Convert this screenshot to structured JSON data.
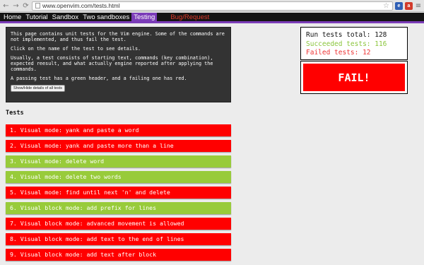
{
  "browser": {
    "url": "www.openvim.com/tests.html",
    "back_icon": "back-arrow-icon",
    "forward_icon": "forward-arrow-icon",
    "reload_icon": "reload-icon",
    "bookmark_icon": "star-icon",
    "menu_icon": "hamburger-menu-icon"
  },
  "nav": {
    "home": "Home",
    "tutorial": "Tutorial",
    "sandbox": "Sandbox",
    "two_sandboxes": "Two sandboxes",
    "testing": "Testing",
    "bug_request": "Bug/Request"
  },
  "info": {
    "paragraph1": "This page contains unit tests for the Vim engine. Some of the commands are not implemented, and thus fail the test.",
    "paragraph2": "Click on the name of the test to see details.",
    "paragraph3": "Usually, a test consists of starting text, commands (key combination), expected reesult, and what actually engine reported after applying the commands.",
    "paragraph4": "A passing test has a green header, and a failing one has red.",
    "toggle_button": "Show/Hide details of all tests"
  },
  "summary": {
    "run_total": "Run tests total: 128",
    "succeeded": "Succeeded tests: 116",
    "failed": "Failed tests: 12",
    "verdict": "FAIL!"
  },
  "colors": {
    "fail": "#ff0000",
    "pass": "#98cb3a",
    "accent": "#7b3cb8"
  },
  "tests_heading": "Tests",
  "tests": [
    {
      "label": "1. Visual mode: yank and paste a word",
      "status": "fail"
    },
    {
      "label": "2. Visual mode: yank and paste more than a line",
      "status": "fail"
    },
    {
      "label": "3. Visual mode: delete word",
      "status": "pass"
    },
    {
      "label": "4. Visual mode: delete two words",
      "status": "pass"
    },
    {
      "label": "5. Visual mode: find until next 'n' and delete",
      "status": "fail"
    },
    {
      "label": "6. Visual block mode: add prefix for lines",
      "status": "pass"
    },
    {
      "label": "7. Visual block mode: advanced movement is allowed",
      "status": "fail"
    },
    {
      "label": "8. Visual block mode: add text to the end of lines",
      "status": "fail"
    },
    {
      "label": "9. Visual block mode: add text after block",
      "status": "fail"
    }
  ]
}
